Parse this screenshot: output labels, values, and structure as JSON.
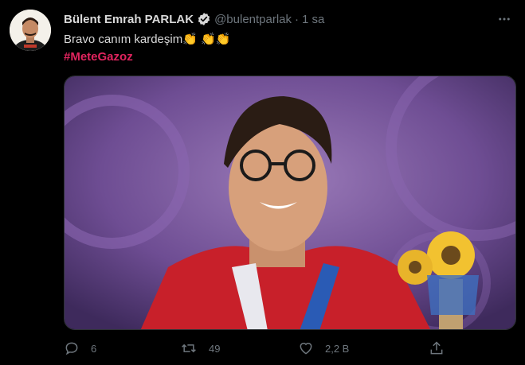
{
  "tweet": {
    "author_name": "Bülent Emrah PARLAK",
    "handle": "@bulentparlak",
    "separator": "·",
    "time": "1 sa",
    "text": "Bravo canım kardeşim",
    "clap_emoji_1": "👏",
    "clap_emoji_2": "👏👏",
    "hashtag": "#MeteGazoz"
  },
  "actions": {
    "reply_count": "6",
    "retweet_count": "49",
    "like_count": "2,2 B"
  },
  "icons": {
    "verified": "verified-badge-icon",
    "more": "more-options-icon",
    "reply": "reply-icon",
    "retweet": "retweet-icon",
    "like": "heart-icon",
    "share": "share-icon"
  },
  "colors": {
    "background": "#000000",
    "text": "#d9d9d9",
    "secondary": "#6e767d",
    "hashtag": "#e0245e",
    "verified": "#d9d9d9"
  }
}
